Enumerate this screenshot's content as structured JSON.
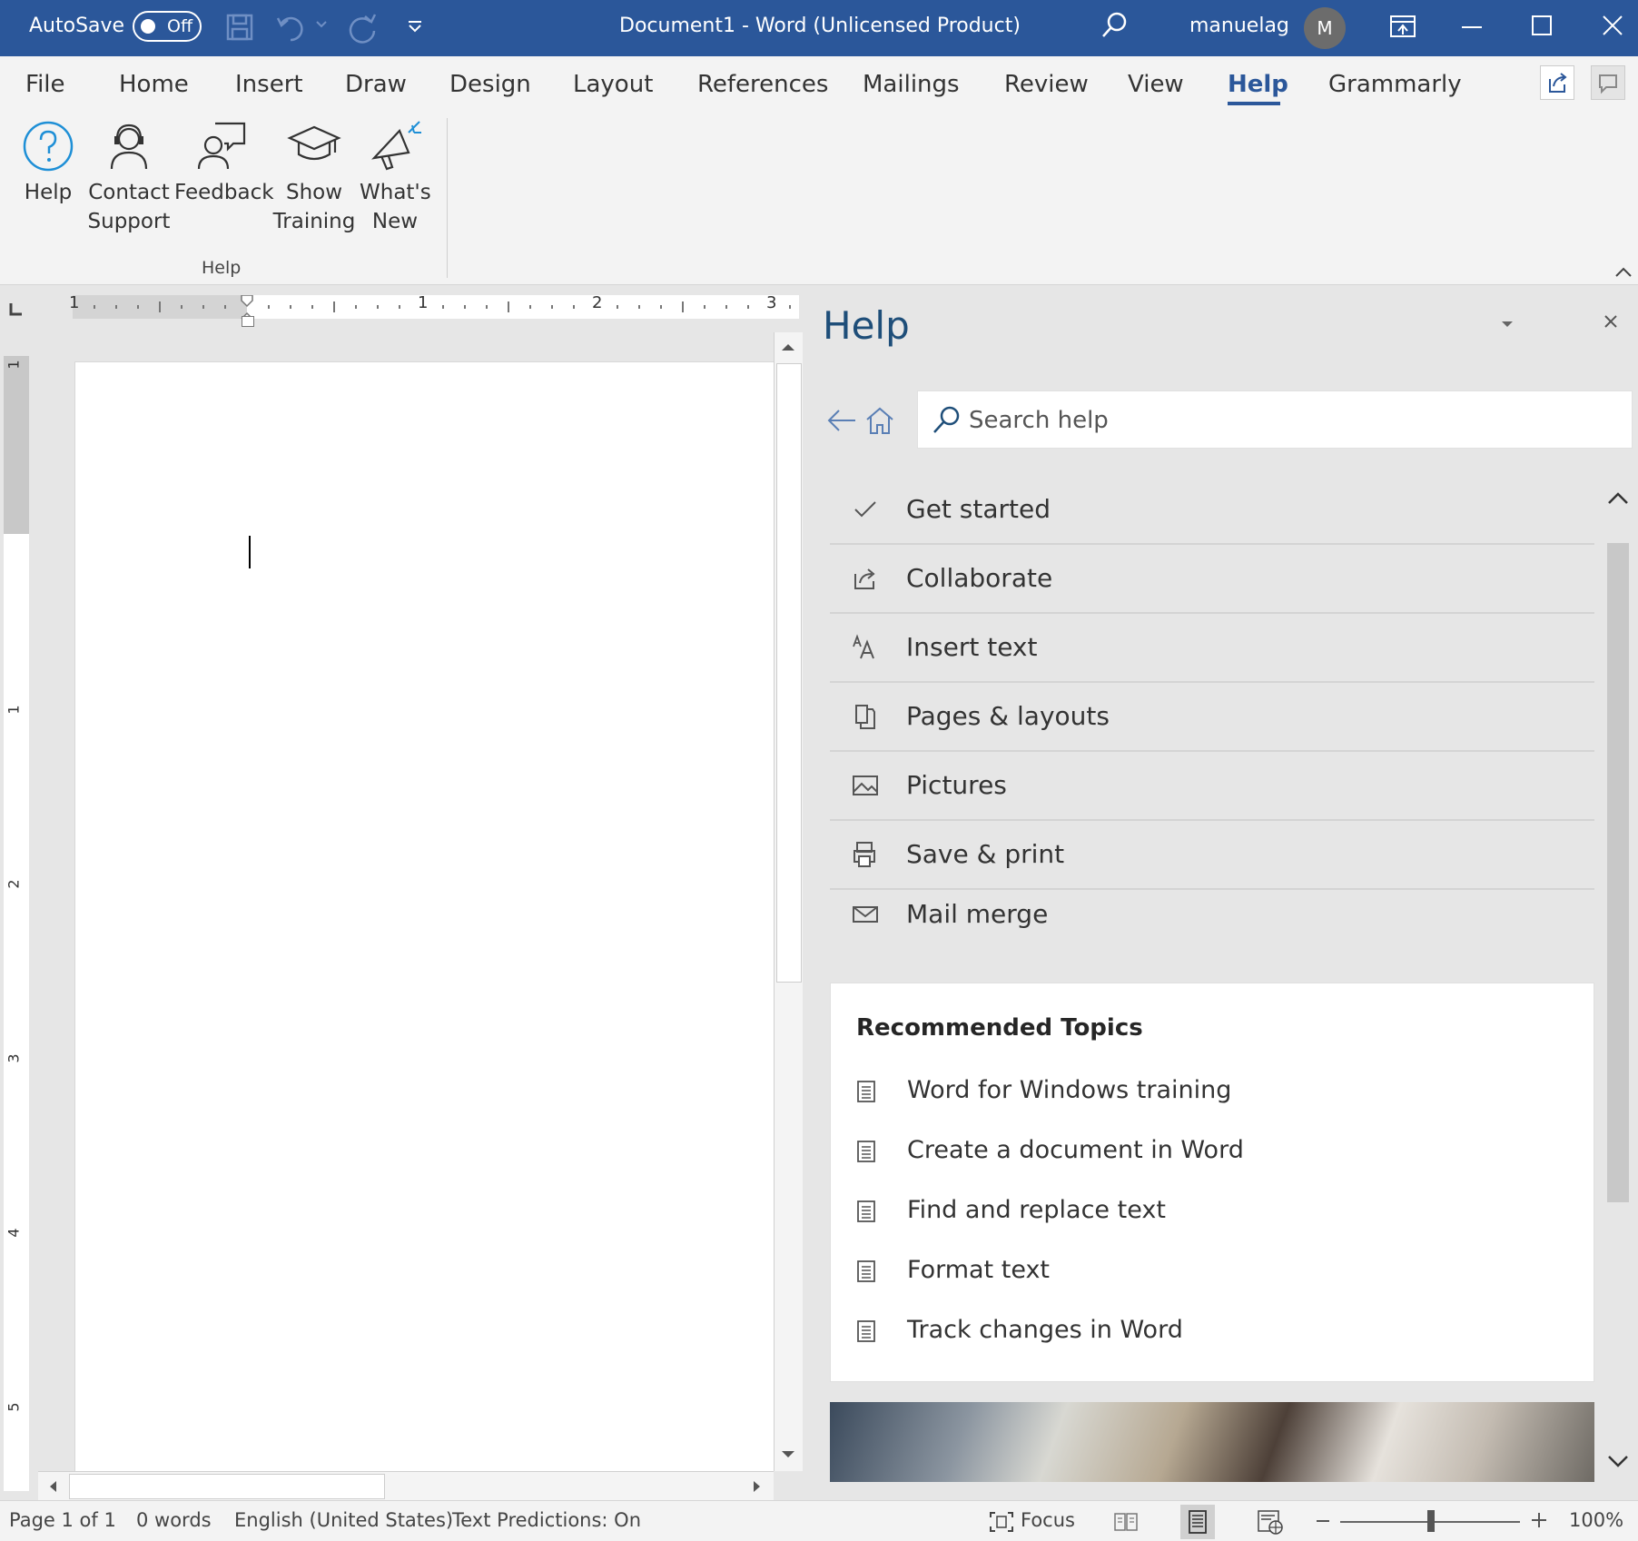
{
  "titlebar": {
    "autosave_label": "AutoSave",
    "autosave_state": "Off",
    "doc_title": "Document1  -  Word (Unlicensed Product)",
    "user_name": "manuelag",
    "avatar_initial": "M",
    "accent": "#2b579a"
  },
  "tabs": [
    "File",
    "Home",
    "Insert",
    "Draw",
    "Design",
    "Layout",
    "References",
    "Mailings",
    "Review",
    "View",
    "Help",
    "Grammarly"
  ],
  "active_tab": "Help",
  "ribbon": {
    "buttons": [
      {
        "label": "Help",
        "icon": "help-circle-icon"
      },
      {
        "label": "Contact\nSupport",
        "icon": "headset-person-icon"
      },
      {
        "label": "Feedback",
        "icon": "feedback-person-icon"
      },
      {
        "label": "Show\nTraining",
        "icon": "graduation-cap-icon"
      },
      {
        "label": "What's\nNew",
        "icon": "megaphone-icon"
      }
    ],
    "group_label": "Help"
  },
  "ruler": {
    "h_labels": [
      "1",
      "1",
      "2",
      "3"
    ],
    "v_labels": [
      "1",
      "1",
      "2",
      "3",
      "4",
      "5"
    ]
  },
  "help_pane": {
    "title": "Help",
    "search_placeholder": "Search help",
    "topics": [
      {
        "label": "Get started",
        "icon": "checkmark-icon"
      },
      {
        "label": "Collaborate",
        "icon": "share-icon"
      },
      {
        "label": "Insert text",
        "icon": "font-size-icon"
      },
      {
        "label": "Pages & layouts",
        "icon": "pages-icon"
      },
      {
        "label": "Pictures",
        "icon": "picture-icon"
      },
      {
        "label": "Save & print",
        "icon": "print-icon"
      },
      {
        "label": "Mail merge",
        "icon": "envelope-icon"
      }
    ],
    "recommended": {
      "heading": "Recommended Topics",
      "items": [
        "Word for Windows training",
        "Create a document in Word",
        "Find and replace text",
        "Format text",
        "Track changes in Word"
      ]
    }
  },
  "status": {
    "page": "Page 1 of 1",
    "words": "0 words",
    "language": "English (United States)",
    "predictions": "Text Predictions: On",
    "focus": "Focus",
    "zoom": "100%"
  }
}
